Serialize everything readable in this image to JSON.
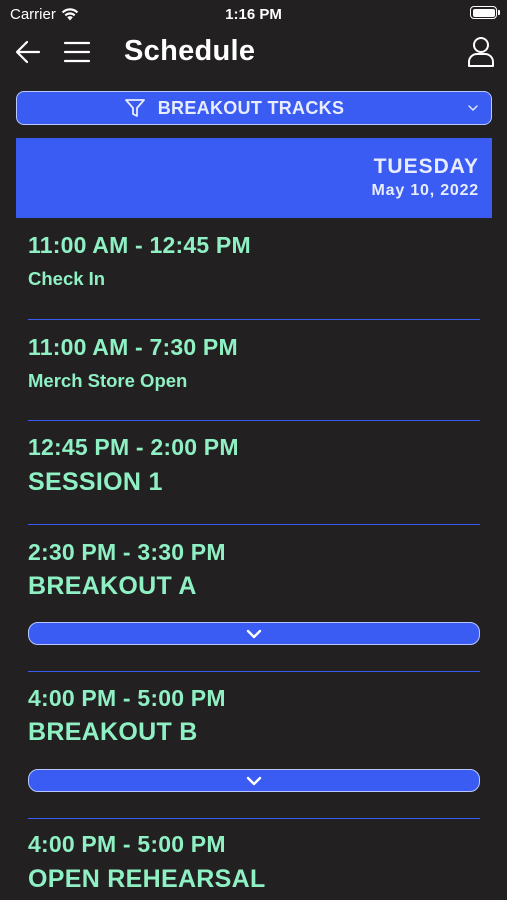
{
  "status_bar": {
    "carrier": "Carrier",
    "time": "1:16 PM"
  },
  "nav": {
    "title": "Schedule",
    "back_icon": "back-arrow-icon",
    "menu_icon": "hamburger-icon",
    "profile_icon": "user-icon"
  },
  "filter": {
    "label": "BREAKOUT TRACKS",
    "icon": "filter-icon"
  },
  "day": {
    "name": "TUESDAY",
    "date": "May 10, 2022"
  },
  "colors": {
    "background": "#232021",
    "accent": "#3a5cf3",
    "text_accent": "#8ff0c4"
  },
  "schedule": [
    {
      "time": "11:00 AM - 12:45 PM",
      "title": "Check In"
    },
    {
      "time": "11:00 AM - 7:30 PM",
      "title": "Merch Store Open"
    },
    {
      "time": "12:45 PM - 2:00 PM",
      "title": "SESSION 1"
    },
    {
      "time": "2:30 PM - 3:30 PM",
      "title": "BREAKOUT A"
    },
    {
      "time": "4:00 PM - 5:00 PM",
      "title": "BREAKOUT B"
    },
    {
      "time": "4:00 PM - 5:00 PM",
      "title": "OPEN REHEARSAL"
    }
  ]
}
